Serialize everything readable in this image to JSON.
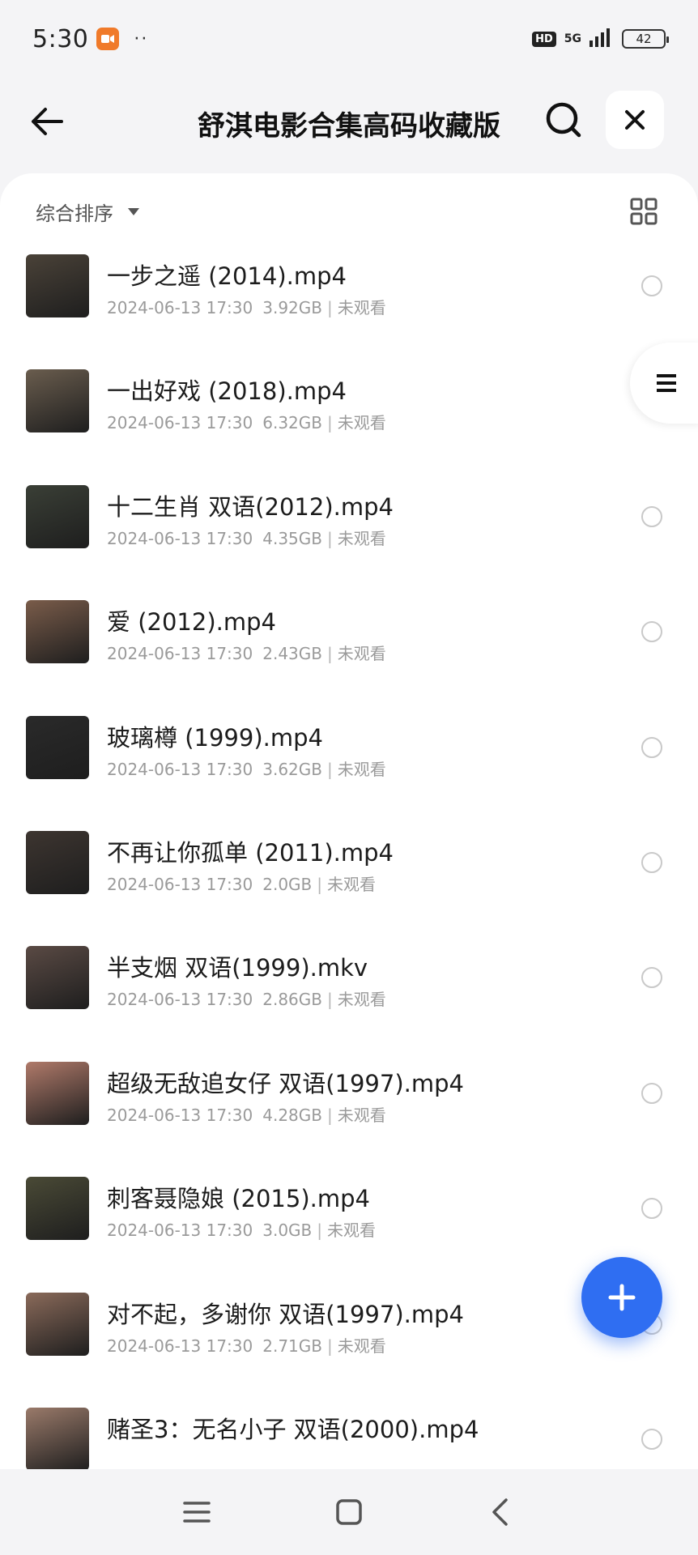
{
  "status_bar": {
    "time": "5:30",
    "dots": "··",
    "hd": "HD",
    "network": "5G",
    "battery": "42"
  },
  "header": {
    "title": "舒淇电影合集高码收藏版"
  },
  "toolbar": {
    "sort_label": "综合排序"
  },
  "files": [
    {
      "name": "一步之遥 (2014).mp4",
      "datetime": "2024-06-13 17:30",
      "size": "3.92GB",
      "status": "未观看",
      "thumb_color": "#4a4238"
    },
    {
      "name": "一出好戏 (2018).mp4",
      "datetime": "2024-06-13 17:30",
      "size": "6.32GB",
      "status": "未观看",
      "thumb_color": "#6a5d4e"
    },
    {
      "name": "十二生肖 双语(2012).mp4",
      "datetime": "2024-06-13 17:30",
      "size": "4.35GB",
      "status": "未观看",
      "thumb_color": "#3a3f36"
    },
    {
      "name": "爱 (2012).mp4",
      "datetime": "2024-06-13 17:30",
      "size": "2.43GB",
      "status": "未观看",
      "thumb_color": "#7a5c4a"
    },
    {
      "name": "玻璃樽 (1999).mp4",
      "datetime": "2024-06-13 17:30",
      "size": "3.62GB",
      "status": "未观看",
      "thumb_color": "#2a2a2a"
    },
    {
      "name": "不再让你孤单 (2011).mp4",
      "datetime": "2024-06-13 17:30",
      "size": "2.0GB",
      "status": "未观看",
      "thumb_color": "#3d3530"
    },
    {
      "name": "半支烟 双语(1999).mkv",
      "datetime": "2024-06-13 17:30",
      "size": "2.86GB",
      "status": "未观看",
      "thumb_color": "#5a4a44"
    },
    {
      "name": "超级无敌追女仔 双语(1997).mp4",
      "datetime": "2024-06-13 17:30",
      "size": "4.28GB",
      "status": "未观看",
      "thumb_color": "#b07a6a"
    },
    {
      "name": "刺客聂隐娘 (2015).mp4",
      "datetime": "2024-06-13 17:30",
      "size": "3.0GB",
      "status": "未观看",
      "thumb_color": "#4a4a36"
    },
    {
      "name": "对不起，多谢你 双语(1997).mp4",
      "datetime": "2024-06-13 17:30",
      "size": "2.71GB",
      "status": "未观看",
      "thumb_color": "#8a6a5a"
    },
    {
      "name": "赌圣3：无名小子 双语(2000).mp4",
      "datetime": "",
      "size": "",
      "status": "",
      "thumb_color": "#9a7a6a"
    }
  ],
  "colors": {
    "accent": "#2f6ef2",
    "record_badge": "#f07a2a"
  },
  "icons": {
    "back": "arrow-left-icon",
    "search": "search-icon",
    "close": "close-icon",
    "grid": "grid-view-icon",
    "side_menu": "menu-icon",
    "fab": "plus-icon",
    "nav_menu": "menu-icon",
    "nav_home": "home-square-icon",
    "nav_back": "chevron-left-icon"
  }
}
